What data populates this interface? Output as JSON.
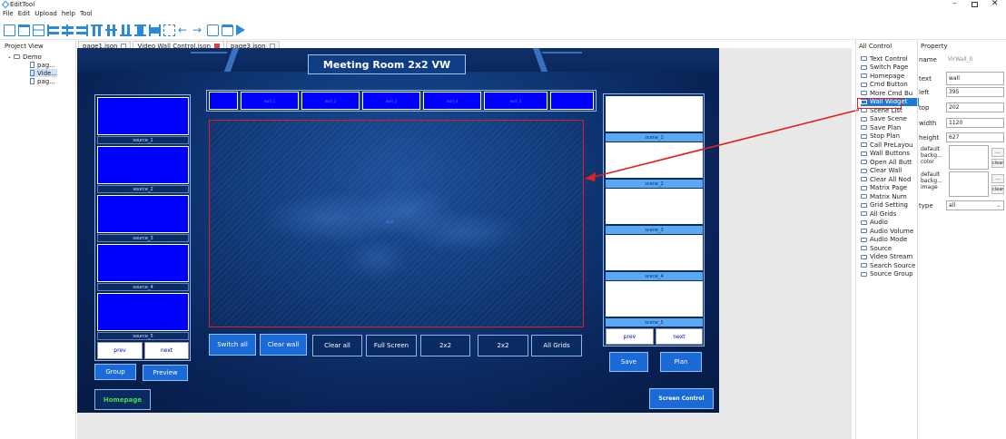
{
  "window": {
    "title": "EditTool"
  },
  "menu": [
    "File",
    "Edit",
    "Upload",
    "help",
    "Tool"
  ],
  "project_view": {
    "header": "Project View",
    "root": "Demo",
    "items": [
      "pag...",
      "Vide...",
      "pag..."
    ]
  },
  "tabs": [
    {
      "label": "page1.json"
    },
    {
      "label": "Video Wall Control.json"
    },
    {
      "label": "page3.json"
    }
  ],
  "canvas": {
    "title": "Meeting Room 2x2 VW",
    "sources": [
      "source_1",
      "source_2",
      "source_3",
      "source_4",
      "source_5"
    ],
    "source_prev": "prev",
    "source_next": "next",
    "walls": [
      "wall_1",
      "wall_2",
      "wall_3",
      "wall_4",
      "wall_5"
    ],
    "wall_center_label": "wall",
    "scenes": [
      "scene_1",
      "scene_2",
      "scene_3",
      "scene_4",
      "scene_5"
    ],
    "scene_prev": "prev",
    "scene_next": "next",
    "buttons": {
      "switch_all": "Switch all",
      "clear_wall": "Clear wall",
      "clear_all": "Clear all",
      "full_screen": "Full Screen",
      "grid1": "2x2",
      "grid2": "2x2",
      "all_grids": "All Grids",
      "group": "Group",
      "preview": "Preview",
      "homepage": "Homepage",
      "save": "Save",
      "plan": "Plan",
      "screen_control": "Screen Control"
    }
  },
  "all_control": {
    "header": "All Control",
    "items": [
      "Text Control",
      "Switch Page",
      "Homepage",
      "Cmd Button",
      "More Cmd Bu",
      "Wall Widget",
      "Scene List",
      "Save Scene",
      "Save Plan",
      "Stop Plan",
      "Call PreLayou",
      "Wall Buttons",
      "Open All Butt",
      "Clear Wall",
      "Clear All Nod",
      "Matrix Page",
      "Matrix Num",
      "Grid Setting",
      "All Grids",
      "Audio",
      "Audio Volume",
      "Audio Mode",
      "Source",
      "Video Stream",
      "Search Source",
      "Source Group"
    ],
    "selected_index": 5
  },
  "property": {
    "header": "Property",
    "name_label": "name",
    "name_value": "VirWall_0",
    "text_label": "text",
    "text_value": "wall",
    "left_label": "left",
    "left_value": "395",
    "top_label": "top",
    "top_value": "202",
    "width_label": "width",
    "width_value": "1120",
    "height_label": "height",
    "height_value": "627",
    "bg_color_label": "default backg... color",
    "bg_image_label": "default backg... image",
    "more_label": "...",
    "clear_label": "clear",
    "type_label": "type",
    "type_value": "all"
  },
  "colors": {
    "accent": "#1a6ad8",
    "highlight": "#e02020",
    "selection": "#1f78d1"
  }
}
